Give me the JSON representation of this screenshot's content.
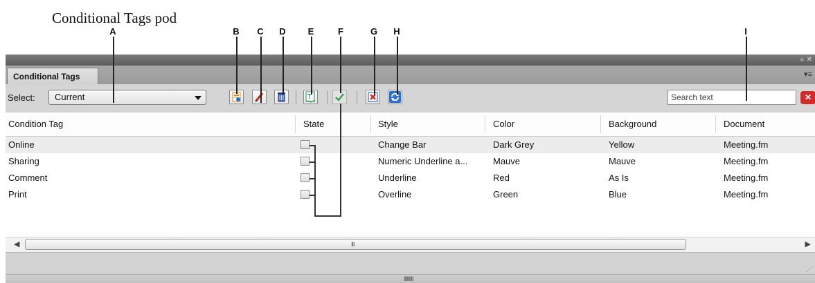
{
  "caption": "Conditional Tags pod",
  "callouts": [
    "A",
    "B",
    "C",
    "D",
    "E",
    "F",
    "G",
    "H",
    "I"
  ],
  "panel": {
    "title_controls": [
      "«",
      "✕"
    ],
    "tab_label": "Conditional Tags",
    "menu_icon": "panel-menu-icon"
  },
  "toolbar": {
    "select_label": "Select:",
    "select_value": "Current",
    "buttons": [
      "new-tag-icon",
      "edit-tag-icon",
      "delete-tag-icon",
      "apply-tag-icon",
      "apply-checkmark-icon",
      "remove-tags-icon",
      "refresh-icon"
    ],
    "search_placeholder": "Search text",
    "clear_icon": "clear-search-icon",
    "clear_color": "#d42a2a"
  },
  "table": {
    "columns": [
      "Condition Tag",
      "State",
      "Style",
      "Color",
      "Background",
      "Document"
    ],
    "rows": [
      {
        "tag": "Online",
        "style": "Change Bar",
        "color": "Dark Grey",
        "background": "Yellow",
        "document": "Meeting.fm"
      },
      {
        "tag": "Sharing",
        "style": "Numeric Underline a...",
        "color": "Mauve",
        "background": "Mauve",
        "document": "Meeting.fm"
      },
      {
        "tag": "Comment",
        "style": "Underline",
        "color": "Red",
        "background": "As Is",
        "document": "Meeting.fm"
      },
      {
        "tag": "Print",
        "style": "Overline",
        "color": "Green",
        "background": "Blue",
        "document": "Meeting.fm"
      }
    ],
    "selected_row": 0
  },
  "scrollbar": {
    "left": "◀",
    "right": "▶",
    "grip": "III"
  },
  "resize_grip": "IIIIIIIII"
}
